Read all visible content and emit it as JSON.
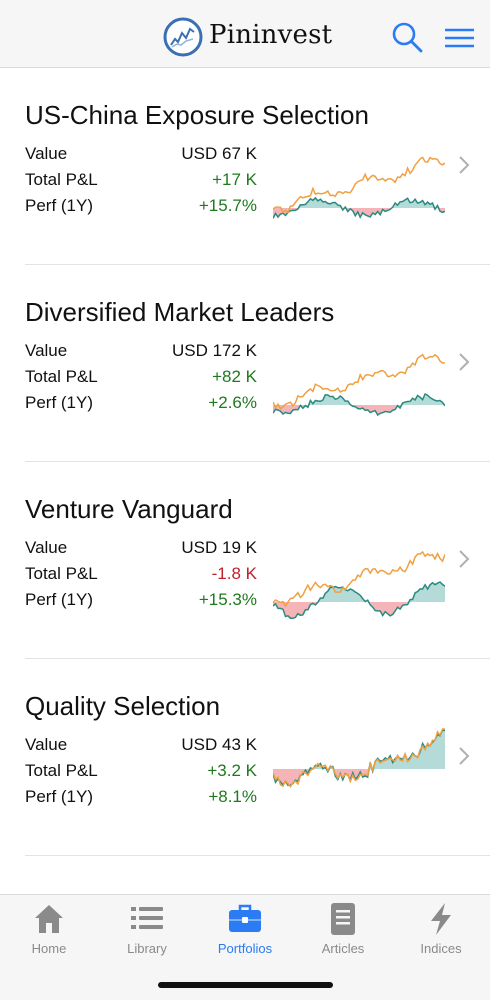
{
  "app": {
    "name": "Pininvest"
  },
  "header": {
    "logo_icon": "pininvest-logo-icon",
    "search_icon": "search-icon",
    "menu_icon": "hamburger-menu-icon"
  },
  "colors": {
    "accent": "#2a7bf4",
    "positive": "#1e7a1e",
    "negative": "#c0212b",
    "series_orange": "#f0a040",
    "series_teal": "#2a8a80",
    "fill_teal": "#b4dbd8",
    "fill_red": "#f5b4b8"
  },
  "portfolios": [
    {
      "name": "US-China Exposure Selection",
      "value_label": "Value",
      "value": "USD 67 K",
      "pnl_label": "Total P&L",
      "pnl": "+17 K",
      "pnl_sign": "pos",
      "perf_label": "Perf (1Y)",
      "perf": "+15.7%",
      "perf_sign": "pos"
    },
    {
      "name": "Diversified Market Leaders",
      "value_label": "Value",
      "value": "USD 172 K",
      "pnl_label": "Total P&L",
      "pnl": "+82 K",
      "pnl_sign": "pos",
      "perf_label": "Perf (1Y)",
      "perf": "+2.6%",
      "perf_sign": "pos"
    },
    {
      "name": "Venture Vanguard",
      "value_label": "Value",
      "value": "USD 19 K",
      "pnl_label": "Total P&L",
      "pnl": "-1.8 K",
      "pnl_sign": "neg",
      "perf_label": "Perf (1Y)",
      "perf": "+15.3%",
      "perf_sign": "pos"
    },
    {
      "name": "Quality Selection",
      "value_label": "Value",
      "value": "USD 43 K",
      "pnl_label": "Total P&L",
      "pnl": "+3.2 K",
      "pnl_sign": "pos",
      "perf_label": "Perf (1Y)",
      "perf": "+8.1%",
      "perf_sign": "pos"
    }
  ],
  "tabs": [
    {
      "label": "Home",
      "icon": "home-icon",
      "active": false
    },
    {
      "label": "Library",
      "icon": "list-icon",
      "active": false
    },
    {
      "label": "Portfolios",
      "icon": "briefcase-icon",
      "active": true
    },
    {
      "label": "Articles",
      "icon": "document-icon",
      "active": false
    },
    {
      "label": "Indices",
      "icon": "lightning-icon",
      "active": false
    }
  ]
}
